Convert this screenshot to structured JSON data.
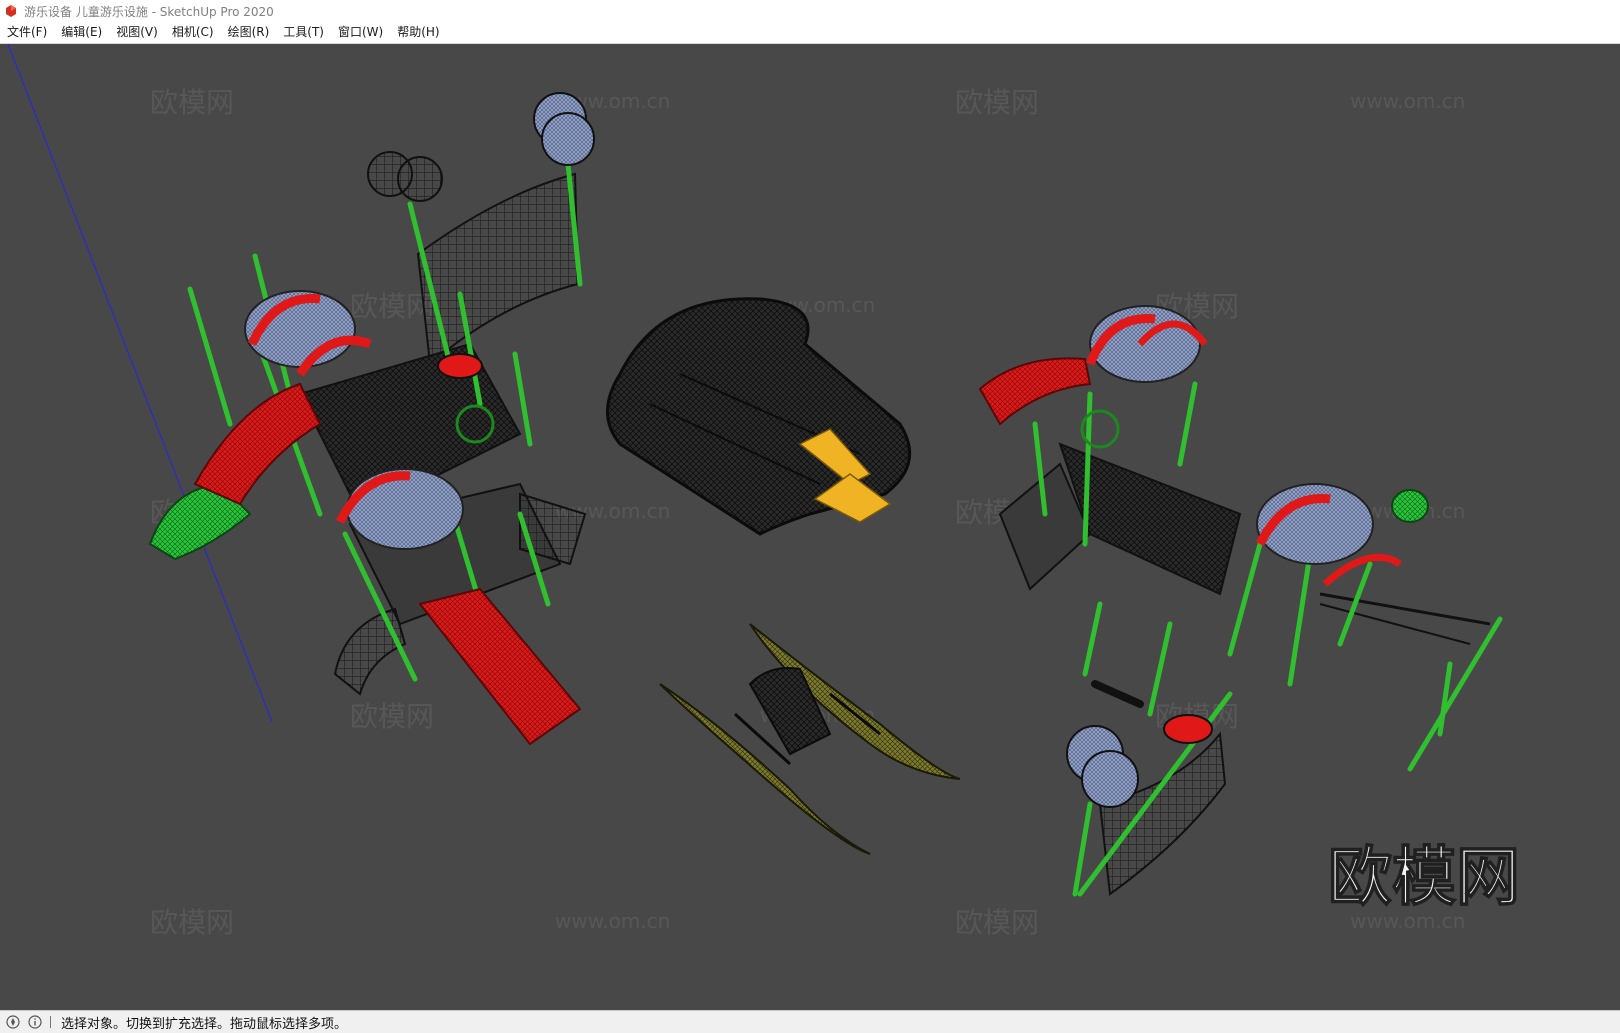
{
  "window": {
    "title": "游乐设备 儿童游乐设施 - SketchUp Pro 2020",
    "app_icon": "sketchup-logo-icon"
  },
  "menu": {
    "items": [
      {
        "label": "文件(F)"
      },
      {
        "label": "编辑(E)"
      },
      {
        "label": "视图(V)"
      },
      {
        "label": "相机(C)"
      },
      {
        "label": "绘图(R)"
      },
      {
        "label": "工具(T)"
      },
      {
        "label": "窗口(W)"
      },
      {
        "label": "帮助(H)"
      }
    ]
  },
  "watermark": {
    "brand": "欧模网",
    "site": "www.om.cn",
    "large_label": "欧模网"
  },
  "viewport": {
    "background": "#484848",
    "model_colors": {
      "post": "#2fbf2f",
      "slide": "#e01818",
      "roof": "#8f9fc4",
      "mesh": "#141414",
      "pedal_boat": "#7a7a2e",
      "fan": "#e8b42a"
    }
  },
  "status": {
    "text": "选择对象。切换到扩充选择。拖动鼠标选择多项。",
    "icons": [
      "geo-location-icon",
      "info-icon"
    ]
  }
}
